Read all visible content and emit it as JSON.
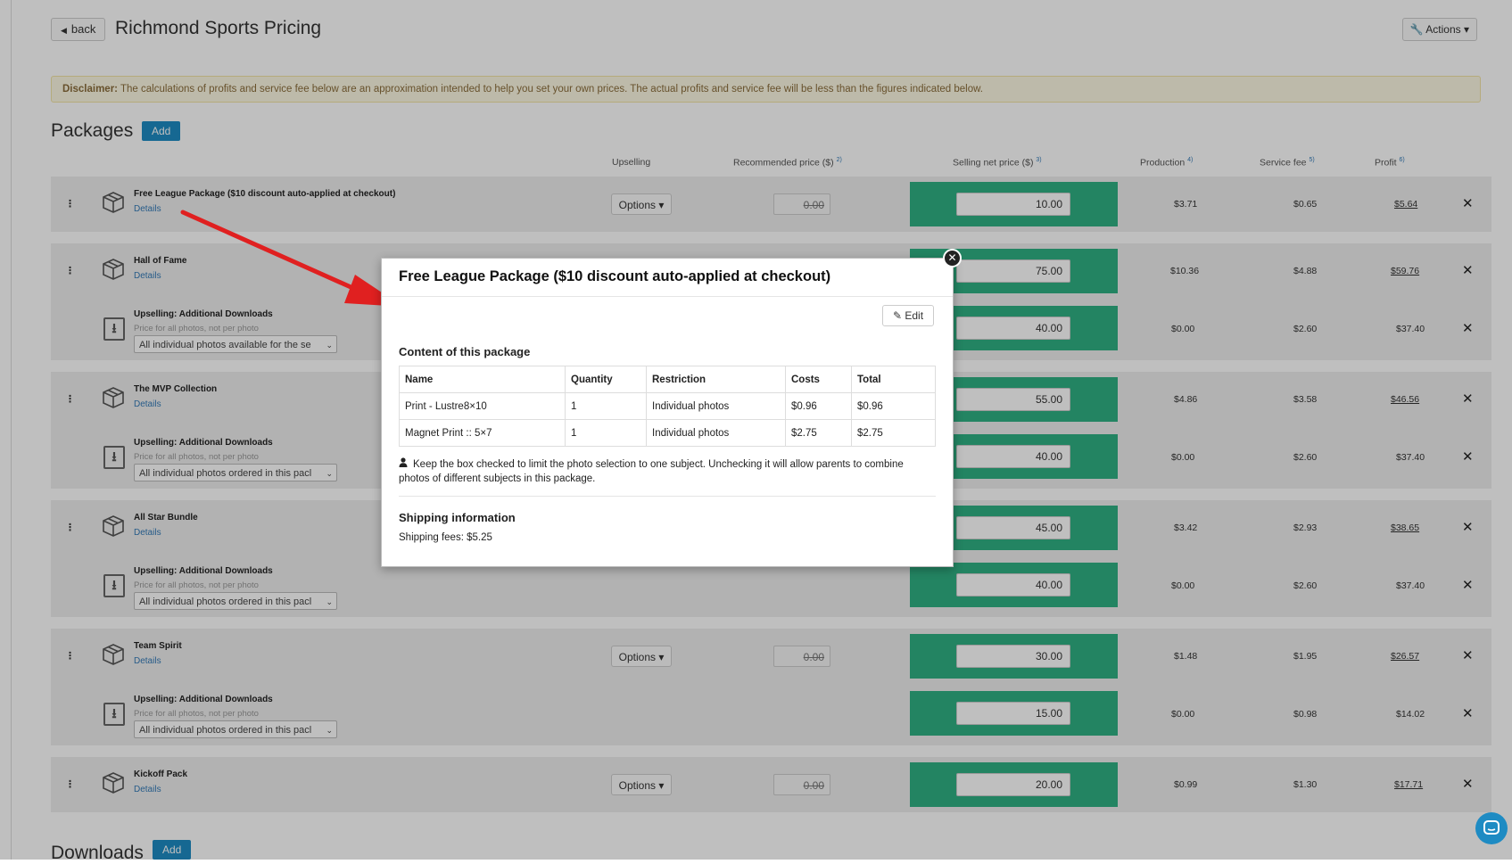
{
  "header": {
    "back_label": "back",
    "title": "Richmond Sports Pricing",
    "actions_label": "Actions"
  },
  "disclaimer": {
    "label": "Disclaimer:",
    "text": "The calculations of profits and service fee below are an approximation intended to help you set your own prices. The actual profits and service fee will be less than the figures indicated below."
  },
  "packages_section": {
    "title": "Packages",
    "add_label": "Add"
  },
  "downloads_section": {
    "title": "Downloads",
    "add_label": "Add"
  },
  "columns": {
    "upselling": "Upselling",
    "recommended_price": "Recommended price ($)",
    "recommended_note": "2)",
    "selling_net_price": "Selling net price ($)",
    "selling_note": "3)",
    "production": "Production",
    "production_note": "4)",
    "service_fee": "Service fee",
    "service_note": "5)",
    "profit": "Profit",
    "profit_note": "6)"
  },
  "row_labels": {
    "details": "Details",
    "options": "Options",
    "upsell_title": "Upselling: Additional Downloads",
    "upsell_sub": "Price for all photos, not per photo",
    "recommended_value": "0.00"
  },
  "packages": [
    {
      "name": "Free League Package ($10 discount auto-applied at checkout)",
      "price": "10.00",
      "production": "$3.71",
      "service_fee": "$0.65",
      "profit": "$5.64",
      "upsell": null
    },
    {
      "name": "Hall of Fame",
      "price": "75.00",
      "production": "$10.36",
      "service_fee": "$4.88",
      "profit": "$59.76",
      "upsell": {
        "select": "All individual photos available for the se",
        "price": "40.00",
        "production": "$0.00",
        "service_fee": "$2.60",
        "profit": "$37.40"
      }
    },
    {
      "name": "The MVP Collection",
      "price": "55.00",
      "production": "$4.86",
      "service_fee": "$3.58",
      "profit": "$46.56",
      "upsell": {
        "select": "All individual photos ordered in this pacl",
        "price": "40.00",
        "production": "$0.00",
        "service_fee": "$2.60",
        "profit": "$37.40"
      }
    },
    {
      "name": "All Star Bundle",
      "price": "45.00",
      "production": "$3.42",
      "service_fee": "$2.93",
      "profit": "$38.65",
      "upsell": {
        "select": "All individual photos ordered in this pacl",
        "price": "40.00",
        "production": "$0.00",
        "service_fee": "$2.60",
        "profit": "$37.40"
      }
    },
    {
      "name": "Team Spirit",
      "price": "30.00",
      "production": "$1.48",
      "service_fee": "$1.95",
      "profit": "$26.57",
      "upsell": {
        "select": "All individual photos ordered in this pacl",
        "price": "15.00",
        "production": "$0.00",
        "service_fee": "$0.98",
        "profit": "$14.02"
      }
    },
    {
      "name": "Kickoff Pack",
      "price": "20.00",
      "production": "$0.99",
      "service_fee": "$1.30",
      "profit": "$17.71",
      "upsell": null
    }
  ],
  "modal": {
    "title": "Free League Package ($10 discount auto-applied at checkout)",
    "edit_label": "Edit",
    "content_heading": "Content of this package",
    "table_headers": [
      "Name",
      "Quantity",
      "Restriction",
      "Costs",
      "Total"
    ],
    "table_rows": [
      [
        "Print - Lustre8×10",
        "1",
        "Individual photos",
        "$0.96",
        "$0.96"
      ],
      [
        "Magnet Print :: 5×7",
        "1",
        "Individual photos",
        "$2.75",
        "$2.75"
      ]
    ],
    "note": "Keep the box checked to limit the photo selection to one subject. Unchecking it will allow parents to combine photos of different subjects in this package.",
    "shipping_heading": "Shipping information",
    "shipping_text": "Shipping fees: $5.25"
  },
  "colors": {
    "accent": "#1e8bc3",
    "selling_green": "#2fb083",
    "arrow_red": "#e02020"
  }
}
